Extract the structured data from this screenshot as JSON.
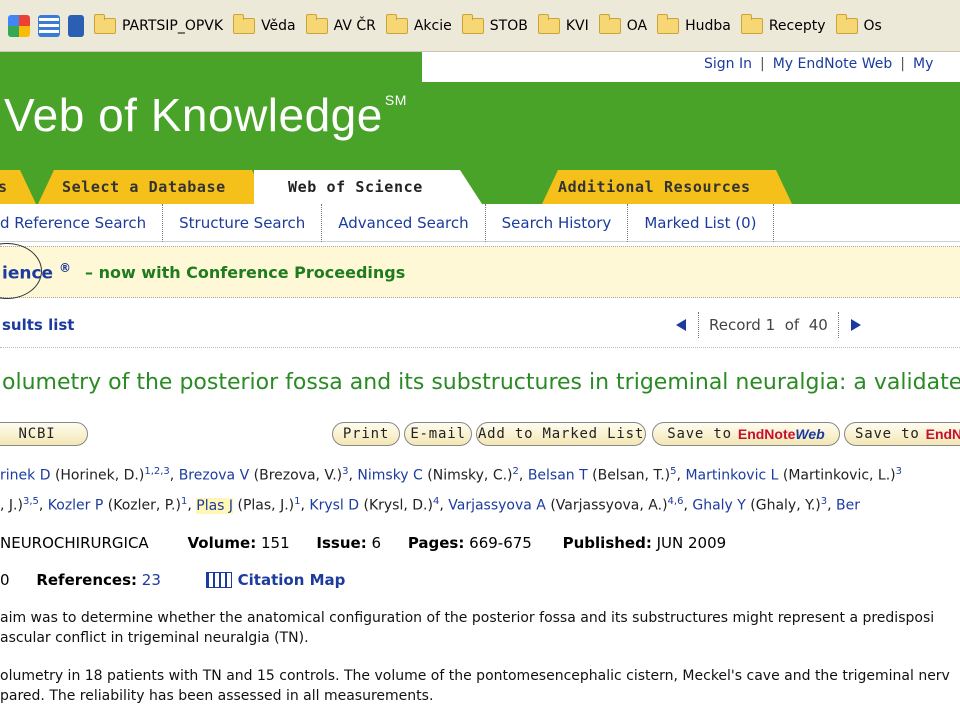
{
  "bookmarks": {
    "items": [
      "PARTSIP_OPVK",
      "Věda",
      "AV ČR",
      "Akcie",
      "STOB",
      "KVI",
      "OA",
      "Hudba",
      "Recepty",
      "Os"
    ]
  },
  "header": {
    "logo": "Veb of Knowledge",
    "logo_sup": "SM",
    "sign_in": "Sign In",
    "my_endnote": "My EndNote Web",
    "my_more": "My"
  },
  "tabs": {
    "left_fragment": "s",
    "select_database": "Select a Database",
    "web_of_science": "Web of Science",
    "additional_resources": "Additional Resources"
  },
  "nav": {
    "items": [
      "d Reference Search",
      "Structure Search",
      "Advanced Search",
      "Search History",
      "Marked List (0)"
    ]
  },
  "banner": {
    "db_name": "ience",
    "db_sup": "®",
    "message": "– now with Conference Proceedings"
  },
  "results": {
    "back": "sults list",
    "record_label": "Record 1",
    "of_label": "of",
    "total": "40"
  },
  "record": {
    "title": "olumetry of the posterior fossa and its substructures in trigeminal neuralgia: a validated s",
    "buttons": {
      "ncbi": "NCBI",
      "print": "Print",
      "email": "E-mail",
      "add_marked": "Add to Marked List",
      "save_to": "Save to",
      "endnote_a": "EndNote",
      "endnote_b": "Web",
      "save_to2": "Save to",
      "endnote_cut": "EndN"
    },
    "authors_line1": [
      {
        "link": "rinek D",
        "paren": "(Horinek, D.)",
        "sup": "1,2,3"
      },
      {
        "link": "Brezova V",
        "paren": "(Brezova, V.)",
        "sup": "3"
      },
      {
        "link": "Nimsky C",
        "paren": "(Nimsky, C.)",
        "sup": "2"
      },
      {
        "link": "Belsan T",
        "paren": "(Belsan, T.)",
        "sup": "5"
      },
      {
        "link": "Martinkovic L",
        "paren": "(Martinkovic, L.)",
        "sup": "3"
      }
    ],
    "authors_line2_prefix": ", J.)",
    "authors_line2_prefix_sup": "3,5",
    "authors_line2": [
      {
        "link": "Kozler P",
        "paren": "(Kozler, P.)",
        "sup": "1"
      },
      {
        "link": "Plas J",
        "paren": "(Plas, J.)",
        "sup": "1"
      },
      {
        "link": "Krysl D",
        "paren": "(Krysl, D.)",
        "sup": "4"
      },
      {
        "link": "Varjassyova A",
        "paren": "(Varjassyova, A.)",
        "sup": "4,6"
      },
      {
        "link": "Ghaly Y",
        "paren": "(Ghaly, Y.)",
        "sup": "3"
      },
      {
        "link": "Ber",
        "paren": "",
        "sup": ""
      }
    ],
    "journal": "NEUROCHIRURGICA",
    "volume_label": "Volume:",
    "volume": "151",
    "issue_label": "Issue:",
    "issue": "6",
    "pages_label": "Pages:",
    "pages": "669-675",
    "published_label": "Published:",
    "published": "JUN 2009",
    "cited_fragment": "0",
    "references_label": "References:",
    "references": "23",
    "citation_map": "Citation Map",
    "abstract_lines": [
      "aim was to determine whether the anatomical configuration of the posterior fossa and its substructures might represent a predisposi",
      "ascular conflict in trigeminal neuralgia (TN).",
      "olumetry in 18 patients with TN and 15 controls. The volume of the pontomesencephalic cistern, Meckel's cave and the trigeminal nerv",
      "pared. The reliability has been assessed in all measurements."
    ]
  }
}
